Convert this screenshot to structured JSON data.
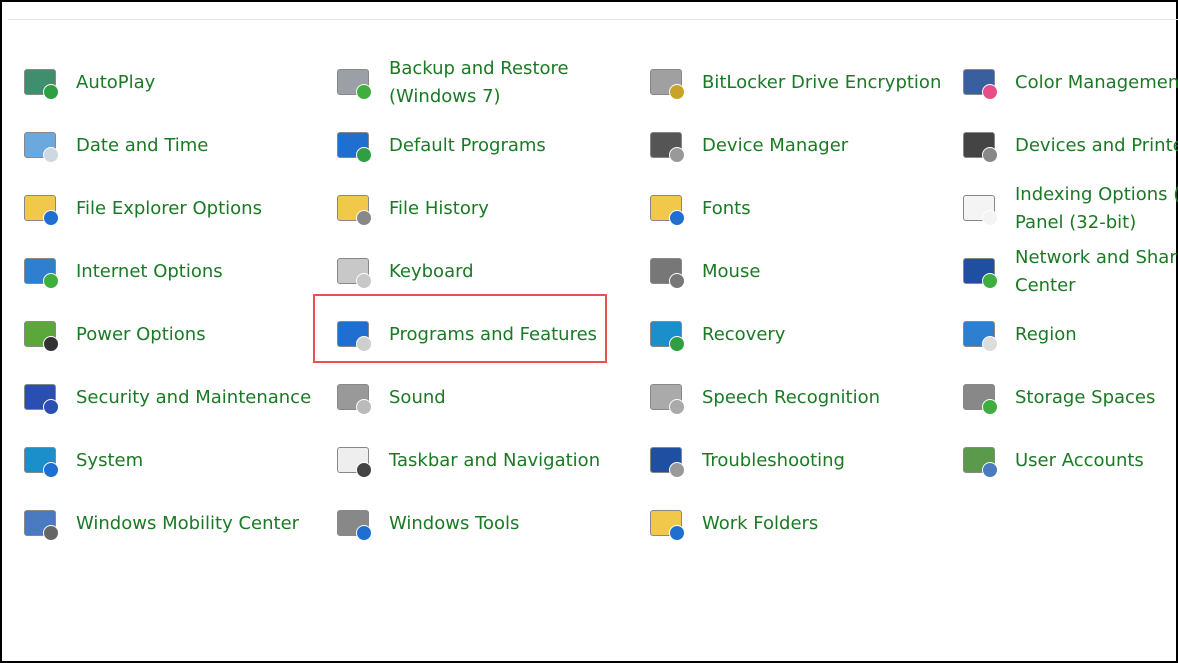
{
  "items": [
    {
      "label": "AutoPlay",
      "icon": "autoplay-icon",
      "c1": "#3f8f6f",
      "c2": "#2ea043"
    },
    {
      "label": "Backup and Restore\n(Windows 7)",
      "icon": "backup-restore-icon",
      "c1": "#9aa0a6",
      "c2": "#3fae3f"
    },
    {
      "label": "BitLocker Drive Encryption",
      "icon": "bitlocker-icon",
      "c1": "#a0a0a0",
      "c2": "#c9a227"
    },
    {
      "label": "Color Managemen",
      "icon": "color-management-icon",
      "c1": "#3a5f9e",
      "c2": "#e84d8a"
    },
    {
      "label": "Date and Time",
      "icon": "date-time-icon",
      "c1": "#6aa8dd",
      "c2": "#cfd8e0"
    },
    {
      "label": "Default Programs",
      "icon": "default-programs-icon",
      "c1": "#1f6fd1",
      "c2": "#2ea043"
    },
    {
      "label": "Device Manager",
      "icon": "device-manager-icon",
      "c1": "#555",
      "c2": "#999"
    },
    {
      "label": "Devices and Printe",
      "icon": "devices-printers-icon",
      "c1": "#444",
      "c2": "#888"
    },
    {
      "label": "File Explorer Options",
      "icon": "file-explorer-options-icon",
      "c1": "#f2c84b",
      "c2": "#1f6fd1"
    },
    {
      "label": "File History",
      "icon": "file-history-icon",
      "c1": "#f2c84b",
      "c2": "#888"
    },
    {
      "label": "Fonts",
      "icon": "fonts-icon",
      "c1": "#f2c84b",
      "c2": "#1f6fd1"
    },
    {
      "label": "Indexing Options (\nPanel (32-bit)",
      "icon": "indexing-options-icon",
      "c1": "#f4f4f4",
      "c2": "#f4f4f4"
    },
    {
      "label": "Internet Options",
      "icon": "internet-options-icon",
      "c1": "#2f7fd0",
      "c2": "#3fae3f"
    },
    {
      "label": "Keyboard",
      "icon": "keyboard-icon",
      "c1": "#c8c8c8",
      "c2": "#c8c8c8"
    },
    {
      "label": "Mouse",
      "icon": "mouse-icon",
      "c1": "#777",
      "c2": "#777"
    },
    {
      "label": "Network and Shar\nCenter",
      "icon": "network-sharing-icon",
      "c1": "#1f4fa0",
      "c2": "#3fae3f"
    },
    {
      "label": "Power Options",
      "icon": "power-options-icon",
      "c1": "#5aa83a",
      "c2": "#333"
    },
    {
      "label": "Programs and Features",
      "icon": "programs-features-icon",
      "c1": "#1f6fd1",
      "c2": "#cfcfcf"
    },
    {
      "label": "Recovery",
      "icon": "recovery-icon",
      "c1": "#1a8fc9",
      "c2": "#2ea043"
    },
    {
      "label": "Region",
      "icon": "region-icon",
      "c1": "#2f7fd0",
      "c2": "#ddd"
    },
    {
      "label": "Security and Maintenance",
      "icon": "security-maintenance-flag-icon",
      "c1": "#2b4fb0",
      "c2": "#2b4fb0"
    },
    {
      "label": "Sound",
      "icon": "sound-icon",
      "c1": "#999",
      "c2": "#bbb"
    },
    {
      "label": "Speech Recognition",
      "icon": "microphone-icon",
      "c1": "#aaa",
      "c2": "#aaa"
    },
    {
      "label": "Storage Spaces",
      "icon": "storage-spaces-icon",
      "c1": "#888",
      "c2": "#3fae3f"
    },
    {
      "label": "System",
      "icon": "system-icon",
      "c1": "#1a8fc9",
      "c2": "#1f6fd1"
    },
    {
      "label": "Taskbar and Navigation",
      "icon": "taskbar-navigation-icon",
      "c1": "#eee",
      "c2": "#444"
    },
    {
      "label": "Troubleshooting",
      "icon": "troubleshooting-icon",
      "c1": "#1f4fa0",
      "c2": "#999"
    },
    {
      "label": "User Accounts",
      "icon": "user-accounts-icon",
      "c1": "#5a9a4a",
      "c2": "#4a7ac0"
    },
    {
      "label": "Windows Mobility Center",
      "icon": "windows-mobility-center-icon",
      "c1": "#4a7ac0",
      "c2": "#666"
    },
    {
      "label": "Windows Tools",
      "icon": "windows-tools-gear-icon",
      "c1": "#888",
      "c2": "#1f6fd1"
    },
    {
      "label": "Work Folders",
      "icon": "work-folders-icon",
      "c1": "#f2c84b",
      "c2": "#1f6fd1"
    }
  ],
  "highlighted": "Programs and Features",
  "highlight_color": "#e5534b",
  "link_color": "#1a7a24"
}
